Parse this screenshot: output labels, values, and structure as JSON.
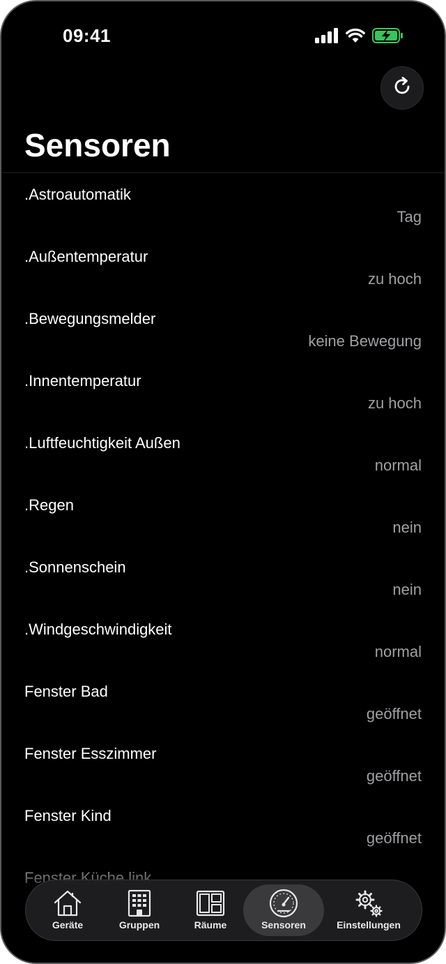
{
  "status_bar": {
    "time": "09:41"
  },
  "header": {
    "title": "Sensoren",
    "refresh_icon": "refresh-icon"
  },
  "sensors": [
    {
      "name": ".Astroautomatik",
      "value": "Tag"
    },
    {
      "name": ".Außentemperatur",
      "value": "zu hoch"
    },
    {
      "name": ".Bewegungsmelder",
      "value": "keine Bewegung"
    },
    {
      "name": ".Innentemperatur",
      "value": "zu hoch"
    },
    {
      "name": ".Luftfeuchtigkeit Außen",
      "value": "normal"
    },
    {
      "name": ".Regen",
      "value": "nein"
    },
    {
      "name": ".Sonnenschein",
      "value": "nein"
    },
    {
      "name": ".Windgeschwindigkeit",
      "value": "normal"
    },
    {
      "name": "Fenster Bad",
      "value": "geöffnet"
    },
    {
      "name": "Fenster Esszimmer",
      "value": "geöffnet"
    },
    {
      "name": "Fenster Kind",
      "value": "geöffnet"
    },
    {
      "name": "Fenster Küche link",
      "value": ""
    }
  ],
  "tab_bar": {
    "tabs": [
      {
        "label": "Geräte",
        "icon": "house-icon",
        "active": false
      },
      {
        "label": "Gruppen",
        "icon": "building-icon",
        "active": false
      },
      {
        "label": "Räume",
        "icon": "rooms-layout-icon",
        "active": false
      },
      {
        "label": "Sensoren",
        "icon": "gauge-icon",
        "active": true
      },
      {
        "label": "Einstellungen",
        "icon": "gears-icon",
        "active": false
      }
    ]
  },
  "colors": {
    "background": "#000000",
    "text_primary": "#ffffff",
    "text_secondary": "#a0a0a4",
    "battery_accent": "#34c759",
    "tab_active_bg": "#3a3a3c"
  }
}
